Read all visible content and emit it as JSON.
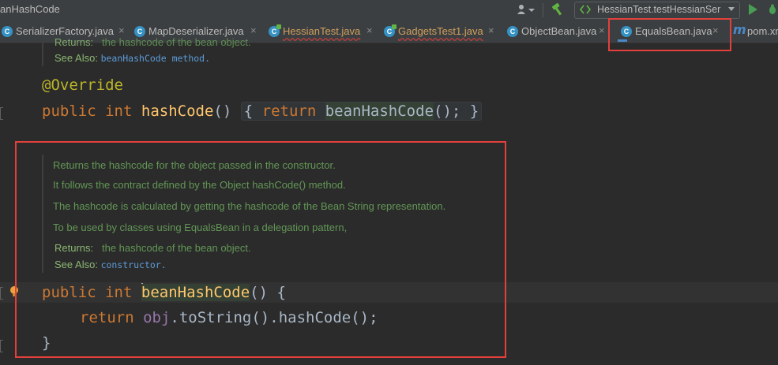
{
  "window": {
    "title": "anHashCode",
    "run_config": "HessianTest.testHessianSer"
  },
  "tabs": [
    {
      "label": "SerializerFactory.java",
      "icon": "class-icon",
      "close": "×"
    },
    {
      "label": "MapDeserializer.java",
      "icon": "class-icon",
      "close": "×"
    },
    {
      "label": "HessianTest.java",
      "icon": "test-class-icon",
      "close": "×"
    },
    {
      "label": "GadgetsTest1.java",
      "icon": "test-class-icon",
      "close": "×"
    },
    {
      "label": "ObjectBean.java",
      "icon": "class-icon",
      "close": "×"
    },
    {
      "label": "EqualsBean.java",
      "icon": "class-icon",
      "close": "×",
      "active": true
    },
    {
      "label": "pom.xm",
      "icon": "maven-icon"
    }
  ],
  "editor": {
    "doc1": {
      "returns_label": "Returns:",
      "returns_text": "the hashcode of the bean object.",
      "see_also_label": "See Also:",
      "see_also_link": "beanHashCode method."
    },
    "annotation": "@Override",
    "method1": {
      "kw_public": "public",
      "kw_int": "int",
      "name": "hashCode",
      "params": "()",
      "open_brace": "{",
      "kw_return": "return",
      "call": "beanHashCode",
      "call_end": "();",
      "close_brace": "}"
    },
    "doc2": {
      "lines": [
        "Returns the hashcode for the object passed in the constructor.",
        "It follows the contract defined by the Object hashCode() method.",
        "The hashcode is calculated by getting the hashcode of the Bean String representation.",
        "To be used by classes using EqualsBean in a delegation pattern,"
      ],
      "returns_label": "Returns:",
      "returns_text": "the hashcode of the bean object.",
      "see_also_label": "See Also:",
      "see_also_link": "constructor."
    },
    "method2": {
      "kw_public": "public",
      "kw_int": "int",
      "name": "beanHashCode",
      "params_open": "() {",
      "kw_return": "return",
      "field": "obj",
      "chain": ".toString().hashCode();",
      "close_brace": "}"
    }
  },
  "colors": {
    "highlight_box": "#e3403b",
    "background": "#2b2b2b",
    "keyword": "#cc7832",
    "function": "#ffc66d",
    "doc": "#629755"
  }
}
